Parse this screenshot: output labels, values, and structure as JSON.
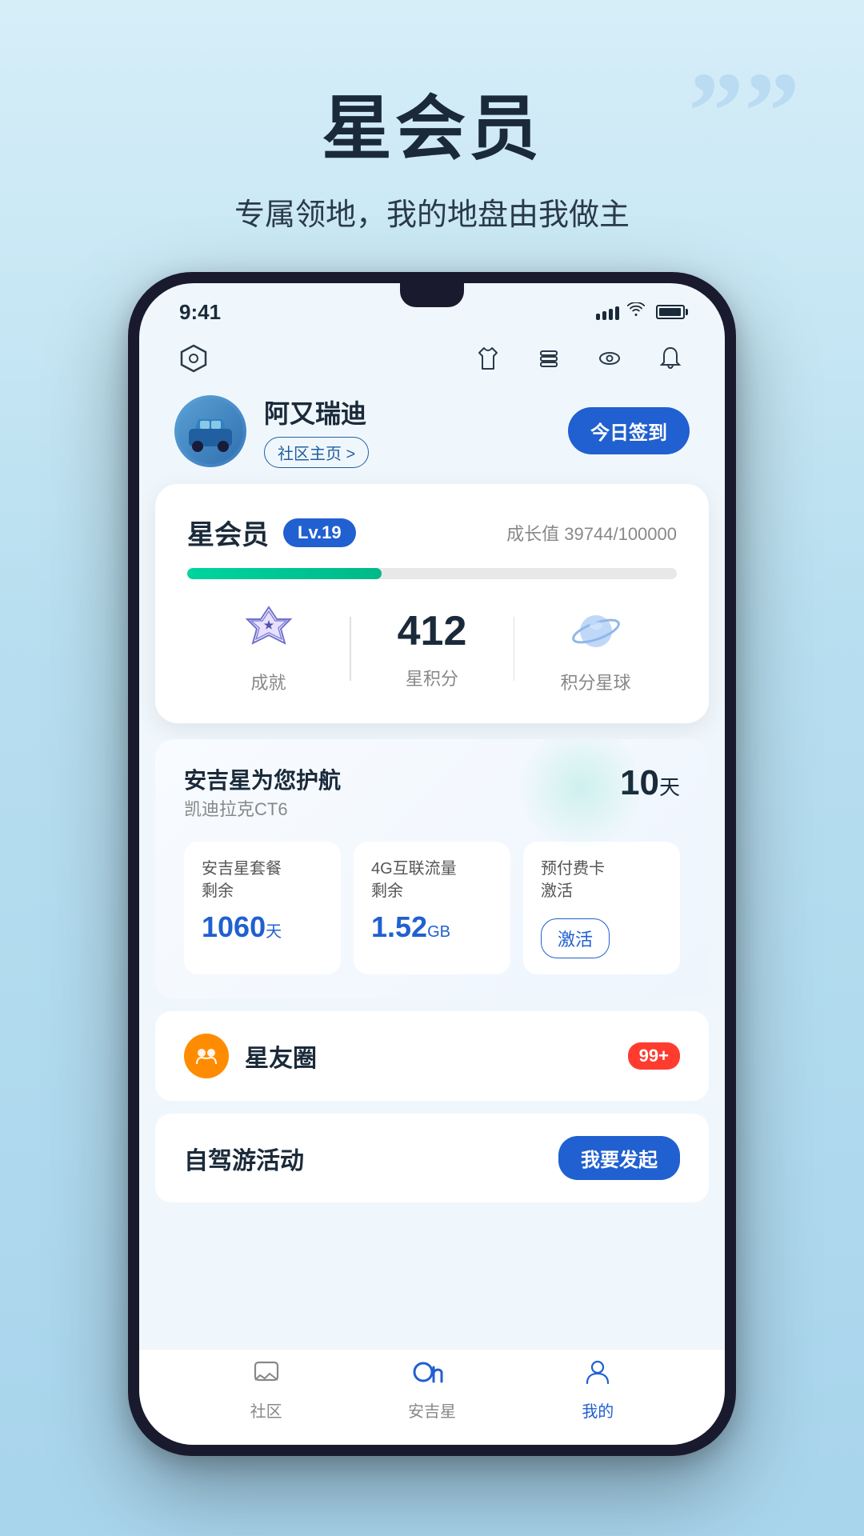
{
  "page": {
    "title": "星会员",
    "subtitle": "专属领地，我的地盘由我做主",
    "deco_quotes": "””"
  },
  "status_bar": {
    "time": "9:41"
  },
  "top_nav": {
    "left_icon": "hexagon-icon",
    "right_icons": [
      "shirt-icon",
      "layers-icon",
      "eye-icon",
      "bell-icon"
    ]
  },
  "user": {
    "name": "阿又瑞迪",
    "community_link": "社区主页 >",
    "checkin_btn": "今日签到"
  },
  "member_card": {
    "title": "星会员",
    "level": "Lv.19",
    "growth_label": "成长值",
    "growth_current": "39744",
    "growth_max": "100000",
    "progress_percent": 39.744,
    "stats": [
      {
        "label": "成就",
        "type": "icon"
      },
      {
        "label": "星积分",
        "value": "412",
        "type": "number"
      },
      {
        "label": "积分星球",
        "type": "icon"
      }
    ]
  },
  "anjistar_card": {
    "title": "安吉星为您护航",
    "subtitle": "凯迪拉克CT6",
    "days_value": "10",
    "days_unit": "天",
    "services": [
      {
        "title": "安吉星套餐\n剩余",
        "value": "1060",
        "unit": "天",
        "type": "value"
      },
      {
        "title": "4G互联流量\n剩余",
        "value": "1.52",
        "unit": "GB",
        "type": "value"
      },
      {
        "title": "预付费卡\n激活",
        "btn_label": "激活",
        "type": "button"
      }
    ]
  },
  "star_circle": {
    "title": "星友圈",
    "badge": "99+"
  },
  "road_trip": {
    "title": "自驾游活动",
    "btn_label": "我要发起"
  },
  "bottom_nav": {
    "tabs": [
      {
        "label": "社区",
        "icon": "community-icon",
        "active": false
      },
      {
        "label": "安吉星",
        "icon": "on-logo",
        "active": false
      },
      {
        "label": "我的",
        "icon": "user-icon",
        "active": true
      }
    ]
  }
}
